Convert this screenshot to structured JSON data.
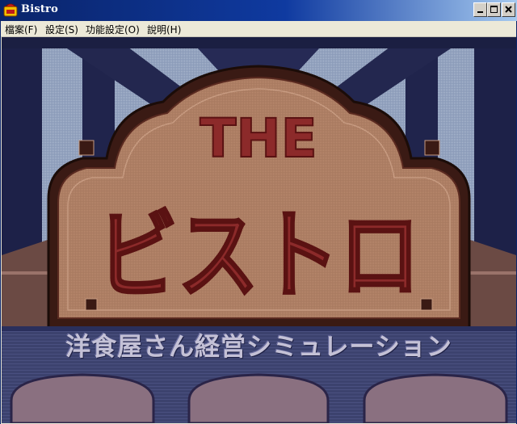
{
  "window": {
    "title": "Bistro",
    "icon": "bistro-app-icon"
  },
  "menu": {
    "items": [
      {
        "label": "檔案(F)"
      },
      {
        "label": "設定(S)"
      },
      {
        "label": "功能設定(O)"
      },
      {
        "label": "說明(H)"
      }
    ]
  },
  "title_screen": {
    "logo_top": "THE",
    "logo_main": "ビストロ",
    "subtitle": "洋食屋さん経営シミュレーション"
  },
  "colors": {
    "titlebar_start": "#0a246a",
    "titlebar_end": "#a6caf0",
    "logo_text": "#8c2a2a",
    "logo_plate": "#b07e62",
    "frame_dark": "#3a1a14",
    "backdrop": "#333a70"
  }
}
